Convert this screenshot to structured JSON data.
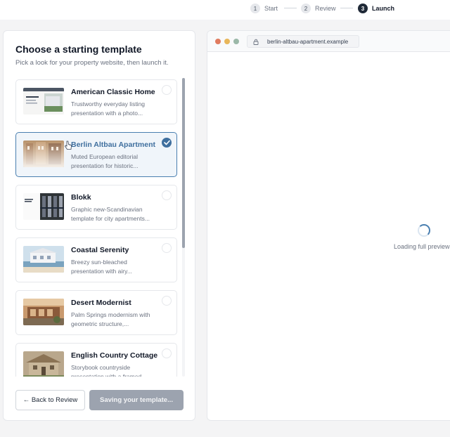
{
  "stepper": {
    "steps": [
      {
        "num": "1",
        "label": "Start"
      },
      {
        "num": "2",
        "label": "Review"
      },
      {
        "num": "3",
        "label": "Launch"
      }
    ]
  },
  "panel": {
    "title": "Choose a starting template",
    "subtitle": "Pick a look for your property website, then launch it.",
    "templates": [
      {
        "name": "American Classic Home",
        "desc": "Trustworthy everyday listing presentation with a photo...",
        "selected": false
      },
      {
        "name": "Berlin Altbau Apartment",
        "desc": "Muted European editorial presentation for historic...",
        "selected": true
      },
      {
        "name": "Blokk",
        "desc": "Graphic new-Scandinavian template for city apartments...",
        "selected": false
      },
      {
        "name": "Coastal Serenity",
        "desc": "Breezy sun-bleached presentation with airy...",
        "selected": false
      },
      {
        "name": "Desert Modernist",
        "desc": "Palm Springs modernism with geometric structure,...",
        "selected": false
      },
      {
        "name": "English Country Cottage",
        "desc": "Storybook countryside presentation with a framed...",
        "selected": false
      }
    ],
    "back_label": "← Back to Review",
    "save_label": "Saving your template..."
  },
  "preview": {
    "url": "berlin-altbau-apartment.example",
    "loading_text": "Loading full preview"
  },
  "colors": {
    "accent": "#3f6f9e",
    "window_dots": [
      "#e07b5f",
      "#e8b65a",
      "#9bb8a8"
    ]
  }
}
